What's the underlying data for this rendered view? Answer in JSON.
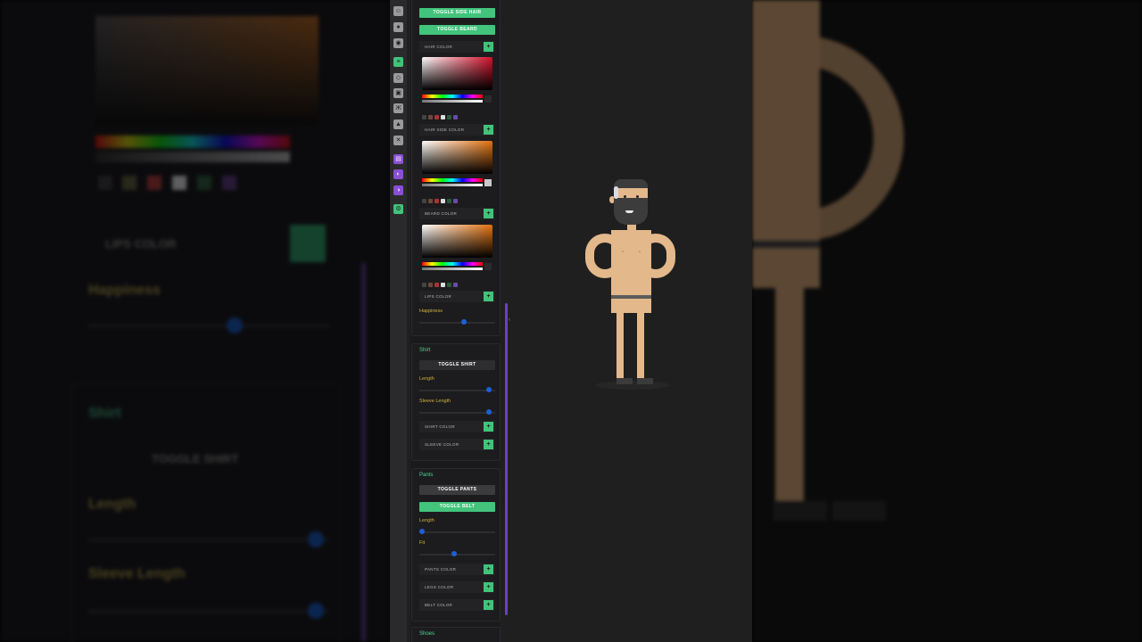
{
  "sidebar_icons": [
    {
      "name": "head-tab-icon",
      "glyph": "☺",
      "color": "gray"
    },
    {
      "name": "hat-tab-icon",
      "glyph": "♠",
      "color": "gray"
    },
    {
      "name": "face-tab-icon",
      "glyph": "◉",
      "color": "gray"
    },
    {
      "name": "hair-tab-icon",
      "glyph": "≡",
      "color": "green"
    },
    {
      "name": "accessory-tab-icon",
      "glyph": "◇",
      "color": "gray"
    },
    {
      "name": "shirt-tab-icon",
      "glyph": "▣",
      "color": "gray"
    },
    {
      "name": "pants-tab-icon",
      "glyph": "Ж",
      "color": "gray"
    },
    {
      "name": "shoes-tab-icon",
      "glyph": "▲",
      "color": "gray"
    },
    {
      "name": "tools-tab-icon",
      "glyph": "✕",
      "color": "gray"
    },
    {
      "name": "save-tab-icon",
      "glyph": "▤",
      "color": "purple"
    },
    {
      "name": "load-tab-icon",
      "glyph": "◐",
      "color": "purple"
    },
    {
      "name": "random-tab-icon",
      "glyph": "◑",
      "color": "purple"
    },
    {
      "name": "settings-tab-icon",
      "glyph": "⚙",
      "color": "green"
    }
  ],
  "hair": {
    "toggle_side_hair": "TOGGLE SIDE HAIR",
    "toggle_beard": "TOGGLE BEARD",
    "hair_color": "HAIR COLOR",
    "hair_side_color": "HAIR SIDE COLOR",
    "beard_color": "BEARD COLOR",
    "lips_color": "LIPS COLOR",
    "happiness": "Happiness",
    "add_symbol": "+",
    "happiness_value": 0.6
  },
  "shirt": {
    "title": "Shirt",
    "toggle": "TOGGLE SHIRT",
    "length": "Length",
    "sleeve_length": "Sleeve Length",
    "shirt_color": "SHIRT COLOR",
    "sleeve_color": "SLEEVE COLOR",
    "length_value": 0.95,
    "sleeve_value": 0.95
  },
  "pants": {
    "title": "Pants",
    "toggle_pants": "TOGGLE PANTS",
    "toggle_belt": "TOGGLE BELT",
    "length": "Length",
    "fit": "Fit",
    "pants_color": "PANTS COLOR",
    "legs_color": "LEGS COLOR",
    "belt_color": "BELT COLOR",
    "length_value": 0.0,
    "fit_value": 0.45
  },
  "shoes": {
    "title": "Shoes"
  },
  "colors": {
    "accent_green": "#42c47c",
    "heading_green": "#4fd690",
    "label_yellow": "#d3b23c",
    "slider_blue": "#1c5fd8",
    "scroll_purple": "#6a3fc6",
    "skin": "#e3b88b",
    "hair": "#3c3c3c"
  },
  "background_zoom": {
    "lips_color": "LIPS COLOR",
    "happiness": "Happiness",
    "shirt": "Shirt",
    "toggle_shirt": "TOGGLE SHIRT",
    "length": "Length",
    "sleeve_length": "Sleeve Length"
  }
}
